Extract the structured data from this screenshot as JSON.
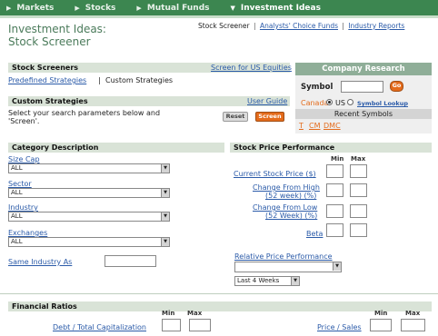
{
  "nav": {
    "items": [
      {
        "label": "Markets",
        "active": false
      },
      {
        "label": "Stocks",
        "active": false
      },
      {
        "label": "Mutual Funds",
        "active": false
      },
      {
        "label": "Investment Ideas",
        "active": true
      }
    ]
  },
  "page": {
    "title_line1": "Investment Ideas:",
    "title_line2": "Stock Screener",
    "top_links": {
      "current": "Stock Screener",
      "analysts": "Analysts' Choice Funds",
      "industry": "Industry Reports",
      "sep": "|"
    }
  },
  "screeners": {
    "header": "Stock Screeners",
    "screen_us": "Screen for US Equities",
    "predefined": "Predefined Strategies",
    "sep": "|",
    "custom_link": "Custom Strategies"
  },
  "custom": {
    "header": "Custom Strategies",
    "guide": "User Guide",
    "instructions": "Select your search parameters below and 'Screen'.",
    "reset": "Reset",
    "screen": "Screen"
  },
  "company_research": {
    "header": "Company Research",
    "symbol_label": "Symbol",
    "go": "Go",
    "canada": "Canada",
    "us": "US",
    "symbol_lookup": "Symbol Lookup",
    "recent_header": "Recent Symbols",
    "recent": [
      "T",
      "CM",
      "DMC"
    ]
  },
  "category": {
    "header": "Category Description",
    "size_cap": {
      "label": "Size Cap",
      "value": "ALL"
    },
    "sector": {
      "label": "Sector",
      "value": "ALL"
    },
    "industry": {
      "label": "Industry",
      "value": "ALL"
    },
    "exchanges": {
      "label": "Exchanges",
      "value": "ALL"
    },
    "same_industry": "Same Industry As"
  },
  "performance": {
    "header": "Stock Price Performance",
    "min": "Min",
    "max": "Max",
    "rows": [
      {
        "line1": "Current Stock Price ($)",
        "line2": ""
      },
      {
        "line1": "Change From High",
        "line2": "(52 week) (%)"
      },
      {
        "line1": "Change From Low",
        "line2": "(52 Week) (%)"
      },
      {
        "line1": "Beta",
        "line2": ""
      }
    ],
    "relative": "Relative Price Performance",
    "period": "Last 4 Weeks"
  },
  "ratios": {
    "header": "Financial Ratios",
    "min": "Min",
    "max": "Max",
    "debt": "Debt / Total Capitalization",
    "price_sales": "Price / Sales"
  },
  "colors": {
    "nav": "#3c8650",
    "title": "#4b7b5b",
    "link": "#2a5aa8",
    "accent": "#e46b1b"
  }
}
